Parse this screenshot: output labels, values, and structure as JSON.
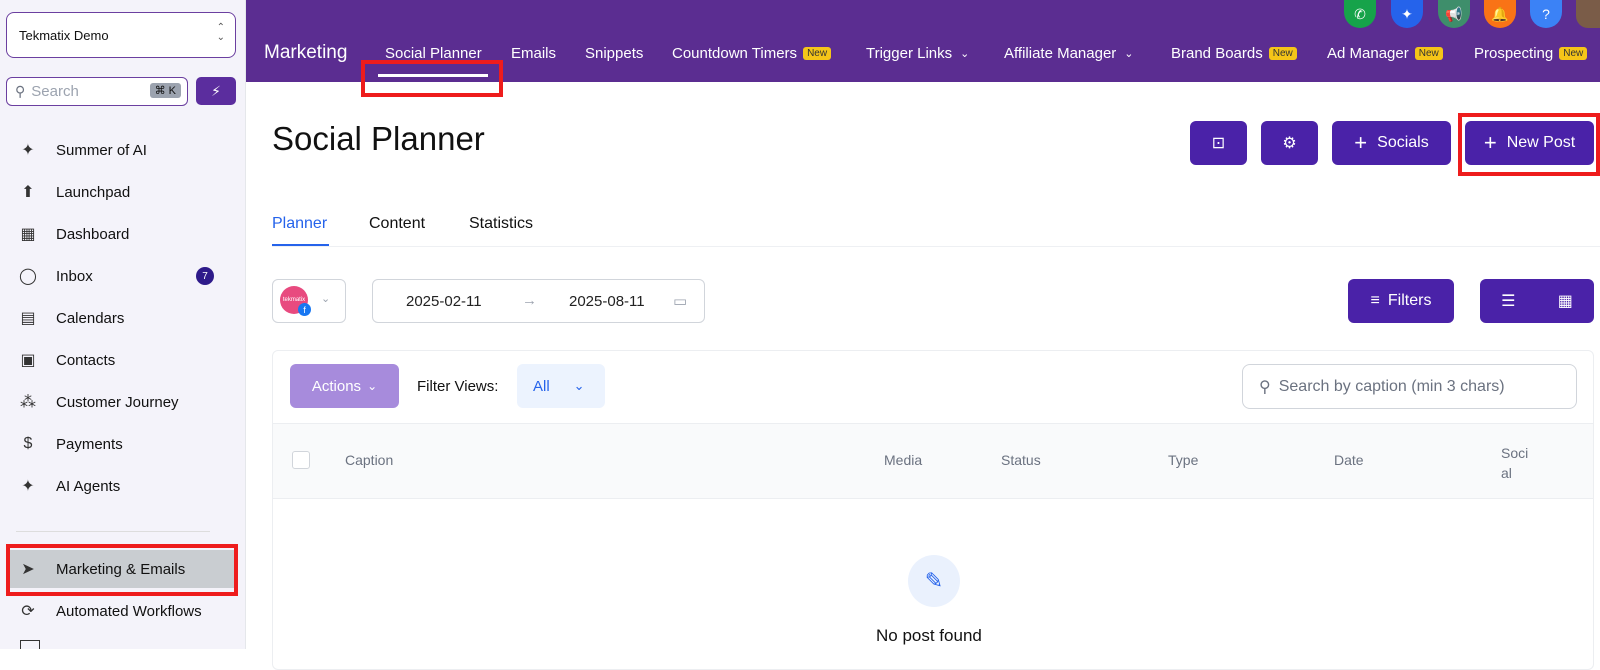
{
  "sidebar": {
    "account_name": "Tekmatix Demo",
    "search_placeholder": "Search",
    "search_shortcut": "⌘ K",
    "items": [
      {
        "label": "Summer of AI",
        "icon": "sparkle-icon"
      },
      {
        "label": "Launchpad",
        "icon": "rocket-icon"
      },
      {
        "label": "Dashboard",
        "icon": "grid-icon"
      },
      {
        "label": "Inbox",
        "icon": "chat-icon",
        "badge": "7"
      },
      {
        "label": "Calendars",
        "icon": "calendar-icon"
      },
      {
        "label": "Contacts",
        "icon": "contacts-icon"
      },
      {
        "label": "Customer Journey",
        "icon": "journey-icon"
      },
      {
        "label": "Payments",
        "icon": "dollar-icon"
      },
      {
        "label": "AI Agents",
        "icon": "sparkle-icon"
      },
      {
        "label": "Marketing & Emails",
        "icon": "send-icon",
        "active": true
      },
      {
        "label": "Automated Workflows",
        "icon": "workflow-icon"
      }
    ]
  },
  "topbar": {
    "section": "Marketing",
    "tabs": [
      {
        "label": "Social Planner",
        "active": true
      },
      {
        "label": "Emails"
      },
      {
        "label": "Snippets"
      },
      {
        "label": "Countdown Timers",
        "new": "New"
      },
      {
        "label": "Trigger Links",
        "dropdown": true
      },
      {
        "label": "Affiliate Manager",
        "dropdown": true
      },
      {
        "label": "Brand Boards",
        "new": "New"
      },
      {
        "label": "Ad Manager",
        "new": "New"
      },
      {
        "label": "Prospecting",
        "new": "New"
      }
    ],
    "icon_colors": {
      "phone": "#16a34a",
      "ai": "#2563eb",
      "megaphone": "#3e8e6b",
      "bell": "#f97316",
      "help": "#3b82f6"
    }
  },
  "main": {
    "title": "Social Planner",
    "buttons": {
      "socials": "Socials",
      "new_post": "New Post"
    },
    "subtabs": [
      "Planner",
      "Content",
      "Statistics"
    ],
    "account_avatar_text": "tekmatix",
    "date_start": "2025-02-11",
    "date_end": "2025-08-11",
    "filters_label": "Filters",
    "actions_label": "Actions",
    "filter_views_label": "Filter Views:",
    "filter_views_value": "All",
    "caption_search_placeholder": "Search by caption (min 3 chars)",
    "columns": [
      "Caption",
      "Media",
      "Status",
      "Type",
      "Date",
      "Soci\nal"
    ],
    "empty_text": "No post found"
  }
}
